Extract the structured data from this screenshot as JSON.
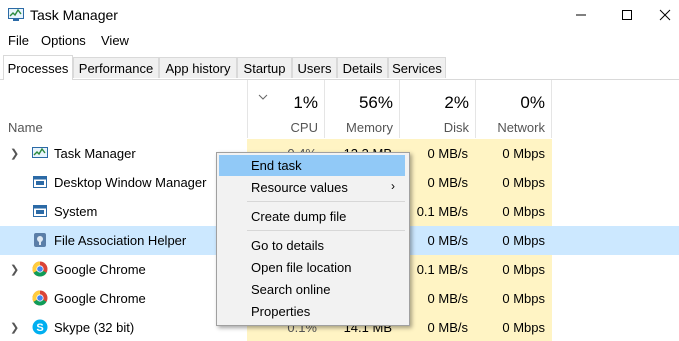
{
  "window": {
    "title": "Task Manager"
  },
  "menu": [
    "File",
    "Options",
    "View"
  ],
  "tabs": [
    "Processes",
    "Performance",
    "App history",
    "Startup",
    "Users",
    "Details",
    "Services"
  ],
  "columns": {
    "name": "Name",
    "cpu": {
      "pct": "1%",
      "label": "CPU"
    },
    "memory": {
      "pct": "56%",
      "label": "Memory"
    },
    "disk": {
      "pct": "2%",
      "label": "Disk"
    },
    "network": {
      "pct": "0%",
      "label": "Network"
    }
  },
  "rows": [
    {
      "name": "Task Manager",
      "cpu": "0.4%",
      "memory": "12.3 MB",
      "disk": "0 MB/s",
      "network": "0 Mbps"
    },
    {
      "name": "Desktop Window Manager",
      "cpu": "",
      "memory": "",
      "disk": "0 MB/s",
      "network": "0 Mbps"
    },
    {
      "name": "System",
      "cpu": "",
      "memory": "",
      "disk": "0.1 MB/s",
      "network": "0 Mbps"
    },
    {
      "name": "File Association Helper",
      "cpu": "",
      "memory": "",
      "disk": "0 MB/s",
      "network": "0 Mbps"
    },
    {
      "name": "Google Chrome",
      "cpu": "",
      "memory": "",
      "disk": "0.1 MB/s",
      "network": "0 Mbps"
    },
    {
      "name": "Google Chrome",
      "cpu": "",
      "memory": "",
      "disk": "0 MB/s",
      "network": "0 Mbps"
    },
    {
      "name": "Skype (32 bit)",
      "cpu": "0.1%",
      "memory": "14.1 MB",
      "disk": "0 MB/s",
      "network": "0 Mbps"
    }
  ],
  "context_menu": {
    "end_task": "End task",
    "resource_values": "Resource values",
    "create_dump": "Create dump file",
    "go_to_details": "Go to details",
    "open_location": "Open file location",
    "search_online": "Search online",
    "properties": "Properties"
  },
  "colors": {
    "highlight": "#cce8ff",
    "heat": "#fff4c4",
    "menu_highlight": "#91c9f7"
  }
}
